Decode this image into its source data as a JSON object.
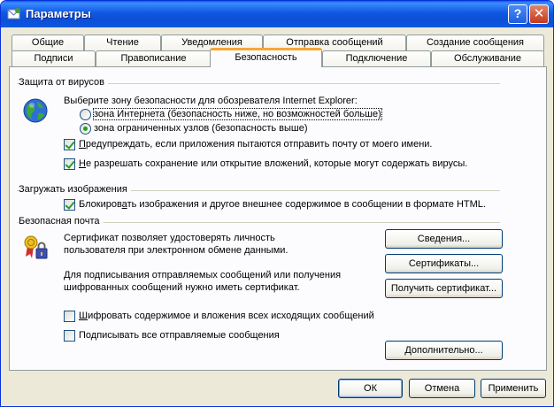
{
  "window": {
    "title": "Параметры",
    "help_label": "?",
    "close_label": "✕"
  },
  "tabs_row1": [
    "Общие",
    "Чтение",
    "Уведомления",
    "Отправка сообщений",
    "Создание сообщения"
  ],
  "tabs_row2": [
    "Подписи",
    "Правописание",
    "Безопасность",
    "Подключение",
    "Обслуживание"
  ],
  "active_tab": "Безопасность",
  "virus": {
    "group": "Защита от вирусов",
    "zone_prompt": "Выберите зону безопасности для обозревателя Internet Explorer:",
    "zone_internet": "зона Интернета (безопасность ниже, но возможностей больше)",
    "zone_restricted": "зона ограниченных узлов (безопасность выше)",
    "selected_zone": "restricted",
    "warn_first": "П",
    "warn_rest": "редупреждать, если приложения пытаются отправить почту от моего имени.",
    "block_first": "Н",
    "block_rest": "е разрешать сохранение или открытие вложений, которые могут содержать вирусы."
  },
  "images": {
    "group": "Загружать изображения",
    "block_pre": "Блокиров",
    "block_u": "а",
    "block_post": "ть изображения и другое внешнее содержимое в сообщении в формате HTML."
  },
  "mail": {
    "group": "Безопасная почта",
    "cert_text_1": "Сертификат позволяет удостоверять личность",
    "cert_text_2": "пользователя при электронном обмене данными.",
    "sign_text_1": "Для подписывания отправляемых сообщений или получения",
    "sign_text_2": "шифрованных сообщений нужно иметь сертификат.",
    "info_button": "Сведения...",
    "certs_button": "Сертификаты...",
    "get_cert_button": "Получить сертификат...",
    "encrypt_first": "Ш",
    "encrypt_rest": "ифровать содержимое и вложения всех исходящих сообщений",
    "sign_all": "Подписывать все отправляемые сообщения",
    "advanced_button": "Дополнительно..."
  },
  "footer": {
    "ok": "ОК",
    "cancel": "Отмена",
    "apply": "Применить"
  }
}
